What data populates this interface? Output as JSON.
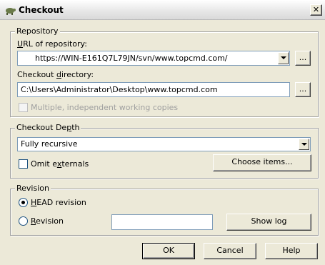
{
  "window": {
    "title": "Checkout",
    "close_label": "✕"
  },
  "repository": {
    "group_label": "Repository",
    "url_label": "URL of repository:",
    "url_value": "https://WIN-E161Q7L79JN/svn/www.topcmd.com/",
    "url_browse": "...",
    "dir_label": "Checkout directory:",
    "dir_value": "C:\\Users\\Administrator\\Desktop\\www.topcmd.com",
    "dir_browse": "...",
    "multiple_label": "Multiple, independent working copies"
  },
  "depth": {
    "group_label": "Checkout Depth",
    "selected": "Fully recursive",
    "omit_label": "Omit externals",
    "choose_label": "Choose items..."
  },
  "revision": {
    "group_label": "Revision",
    "head_label": "HEAD revision",
    "rev_label": "Revision",
    "rev_value": "",
    "show_log_label": "Show log"
  },
  "buttons": {
    "ok": "OK",
    "cancel": "Cancel",
    "help": "Help"
  }
}
